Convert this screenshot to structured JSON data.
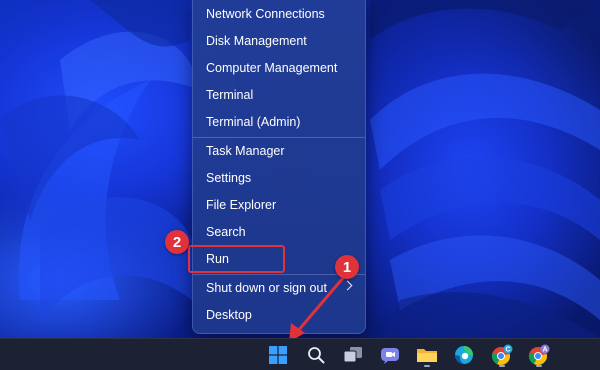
{
  "menu": {
    "items": [
      {
        "label": "Network Connections"
      },
      {
        "label": "Disk Management"
      },
      {
        "label": "Computer Management"
      },
      {
        "label": "Terminal"
      },
      {
        "label": "Terminal (Admin)"
      },
      {
        "label": "Task Manager"
      },
      {
        "label": "Settings"
      },
      {
        "label": "File Explorer"
      },
      {
        "label": "Search"
      },
      {
        "label": "Run"
      },
      {
        "label": "Shut down or sign out"
      },
      {
        "label": "Desktop"
      }
    ]
  },
  "annotations": {
    "step1": "1",
    "step2": "2",
    "color": "#e0323a"
  },
  "taskbar": {
    "icons": [
      {
        "name": "windows-start-icon"
      },
      {
        "name": "search-icon"
      },
      {
        "name": "task-view-icon"
      },
      {
        "name": "teams-chat-icon"
      },
      {
        "name": "file-explorer-icon"
      },
      {
        "name": "edge-icon"
      },
      {
        "name": "chrome-icon"
      },
      {
        "name": "chrome-profile-icon"
      }
    ],
    "chrome_badge_1": "C",
    "chrome_badge_2": "A"
  },
  "colors": {
    "accent_blue": "#1f4cff",
    "taskbar_bg": "#1c2233",
    "menu_bg": "#223e96"
  }
}
